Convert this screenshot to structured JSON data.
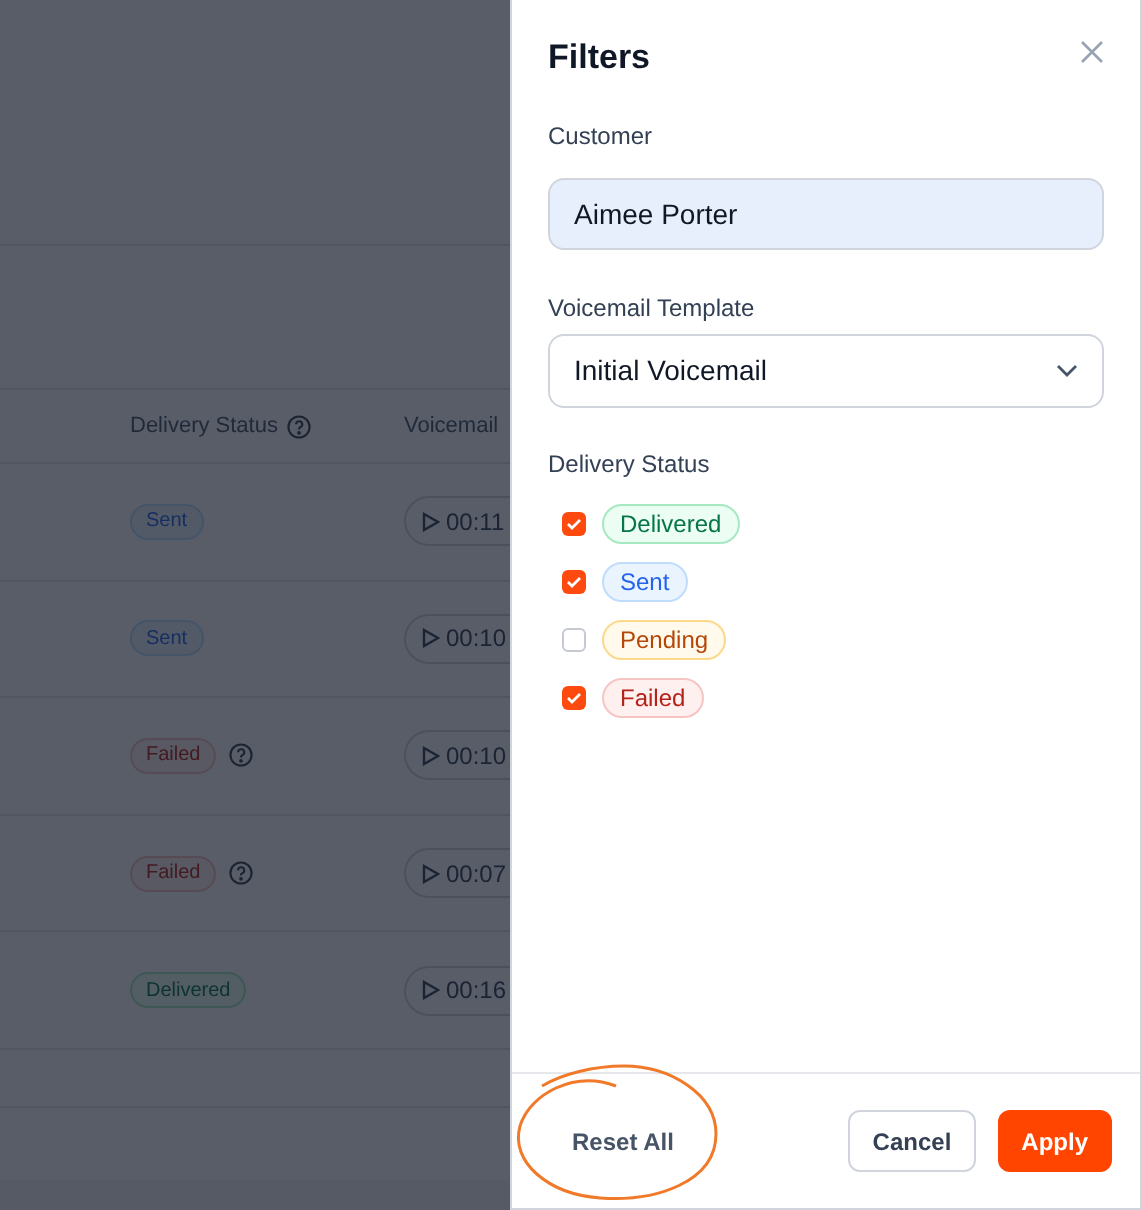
{
  "table": {
    "columns": [
      {
        "label": "Delivery Status",
        "help": true
      },
      {
        "label": "Voicemail",
        "help": false
      }
    ],
    "rows": [
      {
        "status": {
          "label": "Sent",
          "kind": "sent"
        },
        "help": false,
        "duration": "00:11"
      },
      {
        "status": {
          "label": "Sent",
          "kind": "sent"
        },
        "help": false,
        "duration": "00:10"
      },
      {
        "status": {
          "label": "Failed",
          "kind": "failed"
        },
        "help": true,
        "duration": "00:10"
      },
      {
        "status": {
          "label": "Failed",
          "kind": "failed"
        },
        "help": true,
        "duration": "00:07"
      },
      {
        "status": {
          "label": "Delivered",
          "kind": "delivered"
        },
        "help": false,
        "duration": "00:16"
      }
    ]
  },
  "filters": {
    "title": "Filters",
    "customer": {
      "label": "Customer",
      "value": "Aimee Porter"
    },
    "template": {
      "label": "Voicemail Template",
      "value": "Initial Voicemail"
    },
    "delivery_status": {
      "label": "Delivery Status",
      "options": [
        {
          "label": "Delivered",
          "kind": "delivered",
          "checked": true
        },
        {
          "label": "Sent",
          "kind": "sent",
          "checked": true
        },
        {
          "label": "Pending",
          "kind": "pending",
          "checked": false
        },
        {
          "label": "Failed",
          "kind": "failed",
          "checked": true
        }
      ]
    },
    "buttons": {
      "reset": "Reset All",
      "cancel": "Cancel",
      "apply": "Apply"
    }
  }
}
